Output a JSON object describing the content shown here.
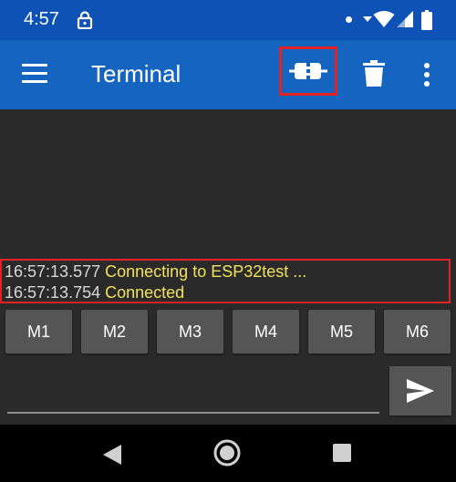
{
  "status_bar": {
    "time": "4:57",
    "icons": [
      "lock-icon",
      "notification-dot",
      "data-arrows-icon",
      "wifi-icon",
      "signal-icon",
      "battery-icon"
    ]
  },
  "app_bar": {
    "title": "Terminal",
    "icons": [
      "menu-icon",
      "connect-plug-icon",
      "trash-icon",
      "more-vert-icon"
    ]
  },
  "log": [
    {
      "time": "16:57:13.577",
      "message": "Connecting to ESP32test ..."
    },
    {
      "time": "16:57:13.754",
      "message": "Connected"
    }
  ],
  "macros": [
    "M1",
    "M2",
    "M3",
    "M4",
    "M5",
    "M6"
  ],
  "input": {
    "value": "",
    "placeholder": ""
  },
  "nav": [
    "back-icon",
    "home-icon",
    "recents-icon"
  ],
  "colors": {
    "status_bar": "#0d52b4",
    "app_bar": "#1565c0",
    "background": "#2a2a2a",
    "highlight": "#e32323",
    "log_time": "#d7d7d7",
    "log_message": "#f2e25a",
    "button": "#555555"
  }
}
